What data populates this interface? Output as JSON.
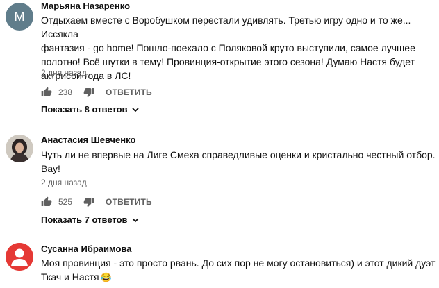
{
  "comments": [
    {
      "avatar_letter": "M",
      "author": "Марьяна Назаренко",
      "text_lines": [
        "Отдыхаем вместе с Воробушком перестали удивлять. Третью игру одно и то же... Иссякла",
        "фантазия - go home! Пошло-поехало с Поляковой круто выступили, самое лучшее",
        "полотно! Всё шутки в тему! Провинция-открытие этого сезона! Думаю Настя будет",
        "актрисой года в ЛС!"
      ],
      "time": "2 дня назад",
      "likes": "238",
      "reply_label": "ОТВЕТИТЬ",
      "replies_label": "Показать 8 ответов"
    },
    {
      "author": "Анастасия Шевченко",
      "text_lines": [
        "Чуть ли не впервые на Лиге Смеха справедливые оценки и кристально честный отбор.",
        "Вау!"
      ],
      "time": "2 дня назад",
      "likes": "525",
      "reply_label": "ОТВЕТИТЬ",
      "replies_label": "Показать 7 ответов"
    },
    {
      "author": "Сусанна Ибраимова",
      "text_lines": [
        "Моя провинция - это просто рвань. До сих пор не могу остановиться) и этот дикий дуэт",
        "Ткач и Настя"
      ],
      "emoji": "😂"
    }
  ],
  "colors": {
    "avatar_m": "#607d8b",
    "avatar_red": "#e53935",
    "secondary_text": "#606060"
  }
}
